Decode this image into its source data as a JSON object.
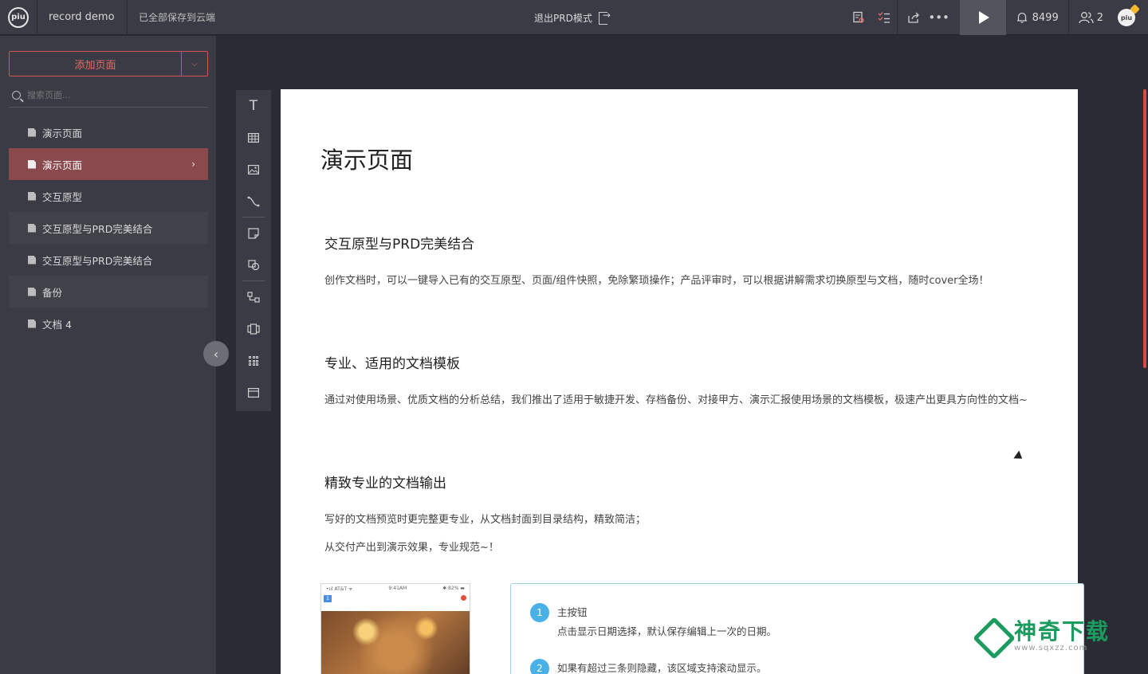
{
  "app": {
    "logo_text": "piu",
    "project_name": "record demo",
    "save_status": "已全部保存到云端",
    "exit_prd_label": "退出PRD模式",
    "notification_count": "8499",
    "user_count": "2",
    "avatar_text": "piu"
  },
  "sidebar": {
    "add_page_label": "添加页面",
    "search_placeholder": "搜索页面...",
    "pages": [
      {
        "label": "演示页面"
      },
      {
        "label": "演示页面"
      },
      {
        "label": "交互原型"
      },
      {
        "label": "交互原型与PRD完美结合"
      },
      {
        "label": "交互原型与PRD完美结合"
      },
      {
        "label": "备份"
      },
      {
        "label": "文档 4"
      }
    ]
  },
  "palette": {
    "text_tool": "T"
  },
  "document": {
    "title": "演示页面",
    "sections": [
      {
        "heading": "交互原型与PRD完美结合",
        "body": "创作文档时，可以一键导入已有的交互原型、页面/组件快照，免除繁琐操作；产品评审时，可以根据讲解需求切换原型与文档，随时cover全场！"
      },
      {
        "heading": "专业、适用的文档模板",
        "body": "通过对使用场景、优质文档的分析总结，我们推出了适用于敏捷开发、存档备份、对接甲方、演示汇报使用场景的文档模板，极速产出更具方向性的文档~"
      },
      {
        "heading": "精致专业的文档输出",
        "body_lines": [
          "写好的文档预览时更完整更专业，从文档封面到目录结构，精致简洁；",
          "从交付产出到演示效果，专业规范~！"
        ]
      }
    ],
    "phone": {
      "carrier": "•ııl AT&T ᯤ",
      "time": "9:41AM",
      "battery": "✱ 82% ▬"
    },
    "notes": [
      {
        "num": "1",
        "title": "主按钮",
        "desc": "点击显示日期选择，默认保存编辑上一次的日期。"
      },
      {
        "num": "2",
        "title": "如果有超过三条则隐藏，该区域支持滚动显示。"
      }
    ]
  },
  "watermark": {
    "title": "神奇下载",
    "url": "www.sqxzz.com"
  },
  "colors": {
    "accent": "#d9534f",
    "active_page": "#8a4a4d",
    "note_num": "#4ab0e8",
    "watermark": "#1b9b5e"
  }
}
